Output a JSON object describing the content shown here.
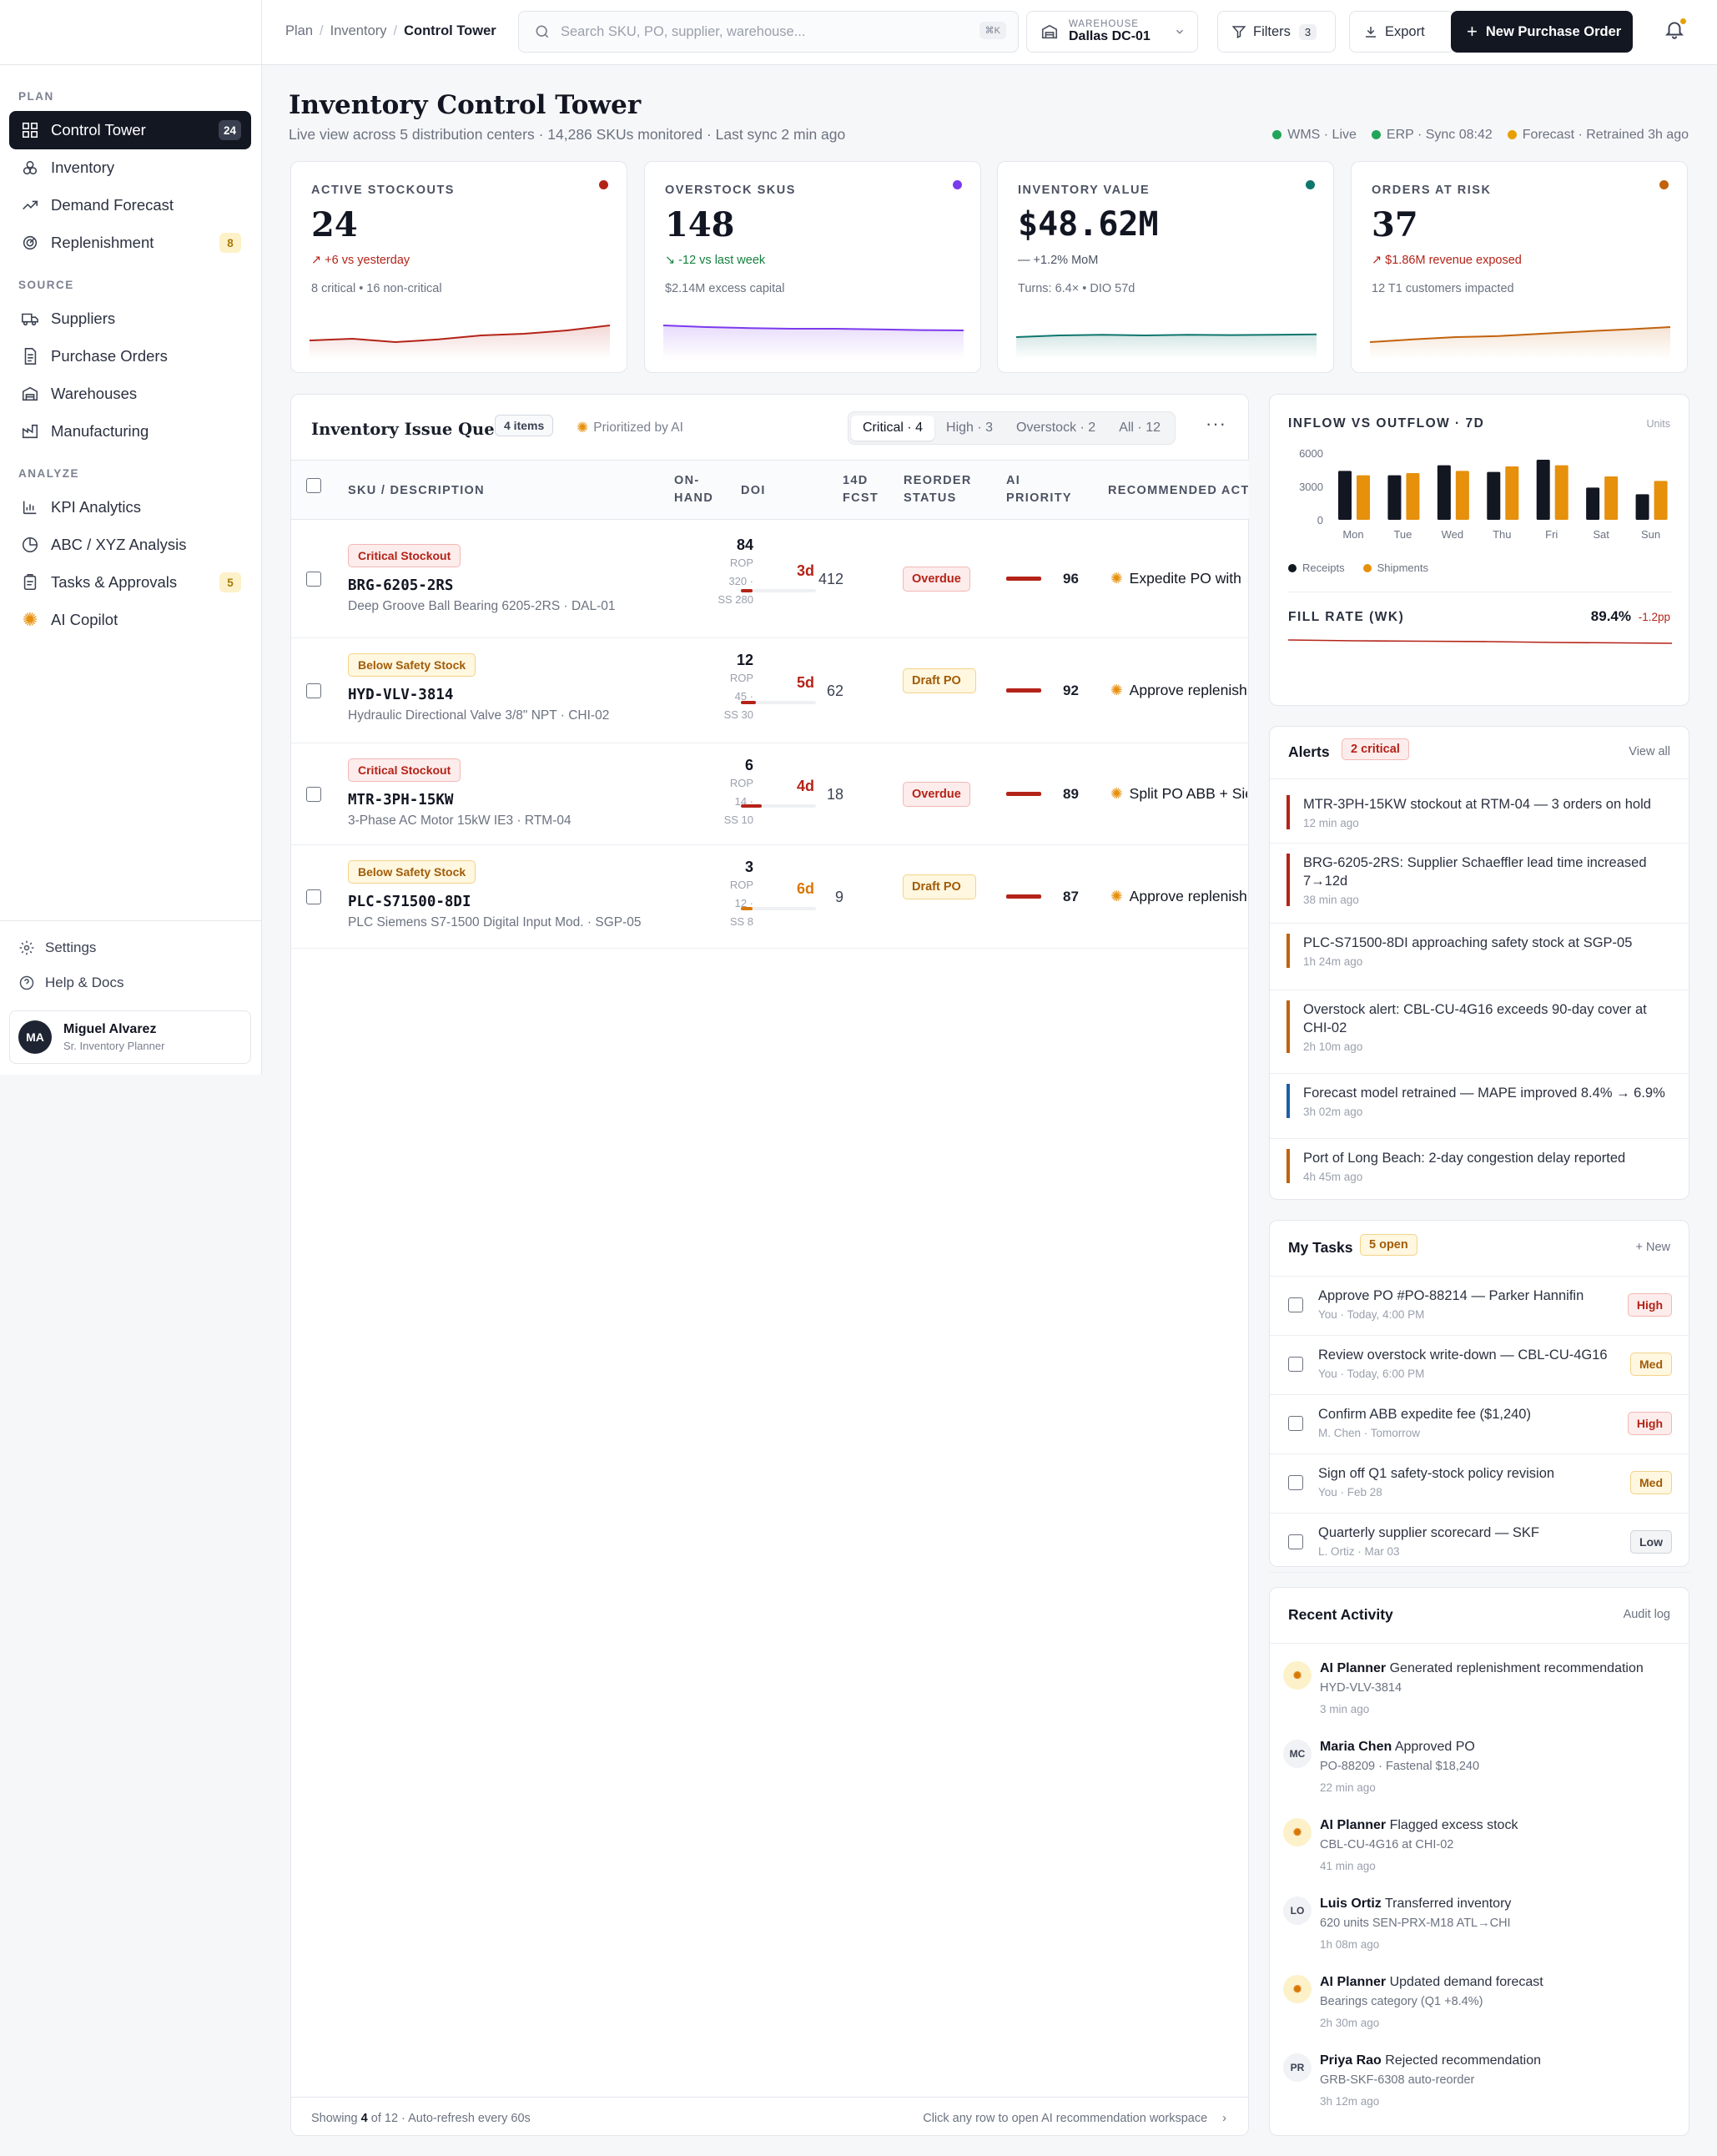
{
  "header": {
    "breadcrumb": [
      "Plan",
      "Inventory",
      "Control Tower"
    ],
    "search_placeholder": "Search SKU, PO, supplier, warehouse...",
    "search_shortcut": "⌘K",
    "warehouse_label": "WAREHOUSE",
    "warehouse_value": "Dallas DC-01",
    "filters_label": "Filters",
    "filters_count": "3",
    "export_label": "Export",
    "new_po_label": "New Purchase Order"
  },
  "sidebar": {
    "sections": [
      {
        "title": "PLAN",
        "items": [
          {
            "label": "Control Tower",
            "badge": "24",
            "active": true
          },
          {
            "label": "Inventory",
            "badge": ""
          },
          {
            "label": "Demand Forecast",
            "badge": ""
          },
          {
            "label": "Replenishment",
            "badge": "8"
          }
        ]
      },
      {
        "title": "SOURCE",
        "items": [
          {
            "label": "Suppliers",
            "badge": ""
          },
          {
            "label": "Purchase Orders",
            "badge": ""
          },
          {
            "label": "Warehouses",
            "badge": ""
          },
          {
            "label": "Manufacturing",
            "badge": ""
          }
        ]
      },
      {
        "title": "ANALYZE",
        "items": [
          {
            "label": "KPI Analytics",
            "badge": ""
          },
          {
            "label": "ABC / XYZ Analysis",
            "badge": ""
          },
          {
            "label": "Tasks & Approvals",
            "badge": "5"
          },
          {
            "label": "AI Copilot",
            "badge": ""
          }
        ]
      }
    ],
    "footer": {
      "settings": "Settings",
      "help": "Help & Docs"
    },
    "user": {
      "initials": "MA",
      "name": "Miguel Alvarez",
      "role": "Sr. Inventory Planner"
    }
  },
  "page": {
    "title": "Inventory Control Tower",
    "subtitle": "Live view across 5 distribution centers · 14,286 SKUs monitored · Last sync 2 min ago",
    "sync": [
      {
        "label": "WMS · Live",
        "color": "#22a55b"
      },
      {
        "label": "ERP · Sync 08:42",
        "color": "#22a55b"
      },
      {
        "label": "Forecast · Retrained 3h ago",
        "color": "#e6a100"
      }
    ]
  },
  "kpis": [
    {
      "label": "ACTIVE STOCKOUTS",
      "value": "24",
      "delta": "↗  +6 vs yesterday",
      "delta_color": "#b42318",
      "note": "8 critical • 16 non-critical",
      "color": "#b42318",
      "trend": [
        0.45,
        0.5,
        0.4,
        0.48,
        0.6,
        0.65,
        0.75,
        0.9
      ]
    },
    {
      "label": "OVERSTOCK SKUS",
      "value": "148",
      "delta": "↘  -12 vs last week",
      "delta_color": "#15803d",
      "note": "$2.14M excess capital",
      "color": "#7c3aed",
      "trend": [
        0.9,
        0.85,
        0.82,
        0.8,
        0.8,
        0.78,
        0.76,
        0.75
      ]
    },
    {
      "label": "INVENTORY VALUE",
      "value": "$48.62M",
      "delta": "—  +1.2% MoM",
      "delta_color": "#4b5262",
      "note": "Turns: 6.4× • DIO 57d",
      "color": "#0f766e",
      "trend": [
        0.55,
        0.6,
        0.62,
        0.6,
        0.62,
        0.61,
        0.62,
        0.63
      ]
    },
    {
      "label": "ORDERS AT RISK",
      "value": "37",
      "delta": "↗  $1.86M revenue exposed",
      "delta_color": "#b42318",
      "note": "12 T1 customers impacted",
      "color": "#c2620c",
      "trend": [
        0.4,
        0.48,
        0.55,
        0.58,
        0.65,
        0.72,
        0.78,
        0.85
      ]
    }
  ],
  "queue": {
    "title": "Inventory Issue Queue",
    "count": "4 items",
    "ai_label": "Prioritized by AI",
    "tabs": [
      "Critical · 4",
      "High · 3",
      "Overstock · 2",
      "All · 12"
    ],
    "columns": {
      "sku": "SKU / DESCRIPTION",
      "onhand": [
        "ON-",
        "HAND"
      ],
      "doi": "DOI",
      "fcst": [
        "14D",
        "FCST"
      ],
      "status": [
        "REORDER",
        "STATUS"
      ],
      "priority": [
        "AI",
        "PRIORITY"
      ],
      "action": "RECOMMENDED ACTION"
    },
    "rows": [
      {
        "tag": "Critical Stockout",
        "tag_type": "crit",
        "sku": "BRG-6205-2RS",
        "desc": "Deep Groove Ball Bearing 6205-2RS · DAL-01",
        "onhand": "84",
        "rop": "ROP 320 ·",
        "ss": "SS 280",
        "doi": "3d",
        "doi_level": 0.15,
        "doi_color": "#b42318",
        "fcst": "412",
        "status": "Overdue",
        "status_type": "over",
        "priority": "96",
        "action": "Expedite PO with"
      },
      {
        "tag": "Below Safety Stock",
        "tag_type": "below",
        "sku": "HYD-VLV-3814",
        "desc": "Hydraulic Directional Valve 3/8\" NPT · CHI-02",
        "onhand": "12",
        "rop": "ROP 45 ·",
        "ss": "SS 30",
        "doi": "5d",
        "doi_level": 0.2,
        "doi_color": "#b42318",
        "fcst": "62",
        "status": "Draft PO",
        "status_type": "draft",
        "priority": "92",
        "action": "Approve replenish"
      },
      {
        "tag": "Critical Stockout",
        "tag_type": "crit",
        "sku": "MTR-3PH-15KW",
        "desc": "3-Phase AC Motor 15kW IE3 · RTM-04",
        "onhand": "6",
        "rop": "ROP 14 ·",
        "ss": "SS 10",
        "doi": "4d",
        "doi_level": 0.28,
        "doi_color": "#b42318",
        "fcst": "18",
        "status": "Overdue",
        "status_type": "over",
        "priority": "89",
        "action": "Split PO ABB + Sie"
      },
      {
        "tag": "Below Safety Stock",
        "tag_type": "below",
        "sku": "PLC-S71500-8DI",
        "desc": "PLC Siemens S7-1500 Digital Input Mod. · SGP-05",
        "onhand": "3",
        "rop": "ROP 12 ·",
        "ss": "SS 8",
        "doi": "6d",
        "doi_level": 0.16,
        "doi_color": "#d97706",
        "fcst": "9",
        "status": "Draft PO",
        "status_type": "draft",
        "priority": "87",
        "action": "Approve replenish"
      }
    ],
    "footer_left_prefix": "Showing",
    "footer_shown": "4",
    "footer_left_suffix": "of 12 · Auto-refresh every 60s",
    "footer_right": "Click any row to open AI recommendation workspace"
  },
  "inflow": {
    "title": "INFLOW VS OUTFLOW · 7D",
    "units": "Units",
    "legend": [
      "Receipts",
      "Shipments"
    ],
    "fill_rate_label": "FILL RATE (WK)",
    "fill_rate_value": "89.4%",
    "fill_rate_delta": "-1.2pp"
  },
  "chart_data": {
    "type": "bar",
    "title": "INFLOW VS OUTFLOW · 7D",
    "categories": [
      "Mon",
      "Tue",
      "Wed",
      "Thu",
      "Fri",
      "Sat",
      "Sun"
    ],
    "ylabel": "Units",
    "ylim": [
      0,
      6000
    ],
    "ticks": [
      "6000",
      "3000",
      "0"
    ],
    "series": [
      {
        "name": "Receipts",
        "color": "#131722",
        "values": [
          4400,
          4000,
          4900,
          4300,
          5400,
          2900,
          2300
        ]
      },
      {
        "name": "Shipments",
        "color": "#e6900c",
        "values": [
          4000,
          4200,
          4400,
          4800,
          4900,
          3900,
          3500
        ]
      }
    ]
  },
  "alerts": {
    "title": "Alerts",
    "badge": "2 critical",
    "view_all": "View all",
    "items": [
      {
        "text": "MTR-3PH-15KW stockout at RTM-04 — 3 orders on hold",
        "time": "12 min ago",
        "color": "#b42318"
      },
      {
        "text": "BRG-6205-2RS: Supplier Schaeffler lead time increased 7→12d",
        "time": "38 min ago",
        "color": "#b42318"
      },
      {
        "text": "PLC-S71500-8DI approaching safety stock at SGP-05",
        "time": "1h 24m ago",
        "color": "#c2620c"
      },
      {
        "text": "Overstock alert: CBL-CU-4G16 exceeds 90-day cover at CHI-02",
        "time": "2h 10m ago",
        "color": "#c2620c"
      },
      {
        "text": "Forecast model retrained — MAPE improved 8.4% → 6.9%",
        "time": "3h 02m ago",
        "color": "#1d5fa8"
      },
      {
        "text": "Port of Long Beach: 2-day congestion delay reported",
        "time": "4h 45m ago",
        "color": "#c2620c"
      }
    ]
  },
  "tasks": {
    "title": "My Tasks",
    "badge": "5 open",
    "new_label": "+ New",
    "items": [
      {
        "text": "Approve PO #PO-88214 — Parker Hannifin",
        "meta": "You · Today, 4:00 PM",
        "priority": "High",
        "type": "high"
      },
      {
        "text": "Review overstock write-down — CBL-CU-4G16",
        "meta": "You · Today, 6:00 PM",
        "priority": "Med",
        "type": "med"
      },
      {
        "text": "Confirm ABB expedite fee ($1,240)",
        "meta": "M. Chen · Tomorrow",
        "priority": "High",
        "type": "high"
      },
      {
        "text": "Sign off Q1 safety-stock policy revision",
        "meta": "You · Feb 28",
        "priority": "Med",
        "type": "med"
      },
      {
        "text": "Quarterly supplier scorecard — SKF",
        "meta": "L. Ortiz · Mar 03",
        "priority": "Low",
        "type": "low"
      }
    ]
  },
  "activity": {
    "title": "Recent Activity",
    "audit": "Audit log",
    "items": [
      {
        "avatar": "",
        "ai": true,
        "actor": "AI Planner",
        "action": "Generated replenishment recommendation",
        "detail": "HYD-VLV-3814",
        "time": "3 min ago"
      },
      {
        "avatar": "MC",
        "ai": false,
        "actor": "Maria Chen",
        "action": "Approved PO",
        "detail": "PO-88209 · Fastenal $18,240",
        "time": "22 min ago"
      },
      {
        "avatar": "",
        "ai": true,
        "actor": "AI Planner",
        "action": "Flagged excess stock",
        "detail": "CBL-CU-4G16 at CHI-02",
        "time": "41 min ago"
      },
      {
        "avatar": "LO",
        "ai": false,
        "actor": "Luis Ortiz",
        "action": "Transferred inventory",
        "detail": "620 units SEN-PRX-M18 ATL→CHI",
        "time": "1h 08m ago"
      },
      {
        "avatar": "",
        "ai": true,
        "actor": "AI Planner",
        "action": "Updated demand forecast",
        "detail": "Bearings category (Q1 +8.4%)",
        "time": "2h 30m ago"
      },
      {
        "avatar": "PR",
        "ai": false,
        "actor": "Priya Rao",
        "action": "Rejected recommendation",
        "detail": "GRB-SKF-6308 auto-reorder",
        "time": "3h 12m ago"
      }
    ]
  }
}
